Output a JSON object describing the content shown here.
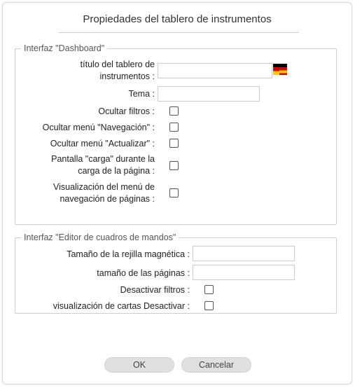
{
  "dialog": {
    "title": "Propiedades del tablero de instrumentos"
  },
  "dashboard_section": {
    "legend": "Interfaz \"Dashboard\"",
    "title_label_line1": "título del tablero de",
    "title_label_line2": "instrumentos :",
    "title_value": "",
    "theme_label": "Tema :",
    "theme_value": "",
    "hide_filters_label": "Ocultar filtros :",
    "hide_nav_menu_label": "Ocultar menú \"Navegación\" :",
    "hide_refresh_menu_label": "Ocultar menú \"Actualizar\" :",
    "loading_screen_line1": "Pantalla \"carga\" durante la",
    "loading_screen_line2": "carga de la página :",
    "page_nav_menu_line1": "Visualización del menú de",
    "page_nav_menu_line2": "navegación de páginas :",
    "checkboxes": {
      "hide_filters": false,
      "hide_nav_menu": false,
      "hide_refresh_menu": false,
      "loading_screen": false,
      "page_nav_menu": false
    }
  },
  "editor_section": {
    "legend": "Interfaz \"Editor de cuadros de mandos\"",
    "grid_size_label": "Tamaño de la rejilla magnética :",
    "grid_size_value": "",
    "page_size_label": "tamaño de las páginas :",
    "page_size_value": "",
    "disable_filters_label": "Desactivar filtros :",
    "disable_charts_label": "visualización de cartas Desactivar :",
    "checkboxes": {
      "disable_filters": false,
      "disable_charts": false
    }
  },
  "buttons": {
    "ok_label": "OK",
    "cancel_label": "Cancelar"
  },
  "colors": {
    "flag_red": "#d40000",
    "flag_yellow": "#ffce00",
    "flag_black": "#000000"
  }
}
